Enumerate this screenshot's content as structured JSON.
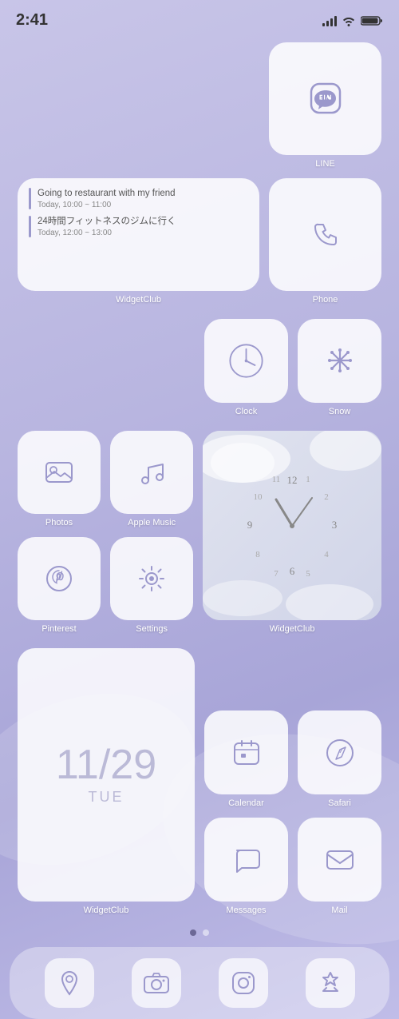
{
  "statusBar": {
    "time": "2:41",
    "signal": "●●●●",
    "wifi": "wifi",
    "battery": "battery"
  },
  "rows": [
    {
      "id": "row1",
      "items": [
        {
          "id": "widgetclub-schedule",
          "type": "widget-large",
          "label": "WidgetClub",
          "events": [
            {
              "title": "Going to restaurant with my friend",
              "time": "Today, 10:00 ~ 11:00"
            },
            {
              "title": "24時間フィットネスのジムに行く",
              "time": "Today, 12:00 ~ 13:00"
            }
          ]
        },
        {
          "id": "line",
          "type": "app",
          "label": "LINE",
          "icon": "line"
        },
        {
          "id": "phone",
          "type": "app",
          "label": "Phone",
          "icon": "phone"
        }
      ]
    },
    {
      "id": "row2",
      "items": [
        {
          "id": "clock",
          "type": "app",
          "label": "Clock",
          "icon": "clock"
        },
        {
          "id": "snow",
          "type": "app",
          "label": "Snow",
          "icon": "snow"
        }
      ]
    },
    {
      "id": "row3",
      "items": [
        {
          "id": "photos",
          "type": "app",
          "label": "Photos",
          "icon": "photos"
        },
        {
          "id": "apple-music",
          "type": "app",
          "label": "Apple Music",
          "icon": "music"
        },
        {
          "id": "widgetclub-clock",
          "type": "widget-clock",
          "label": "WidgetClub",
          "icon": "clock-widget"
        }
      ]
    },
    {
      "id": "row4",
      "items": [
        {
          "id": "pinterest",
          "type": "app",
          "label": "Pinterest",
          "icon": "pinterest"
        },
        {
          "id": "settings",
          "type": "app",
          "label": "Settings",
          "icon": "settings"
        }
      ]
    },
    {
      "id": "row5",
      "items": [
        {
          "id": "widgetclub-date",
          "type": "widget-date",
          "label": "WidgetClub",
          "date": "11/29",
          "day": "TUE"
        },
        {
          "id": "calendar",
          "type": "app",
          "label": "Calendar",
          "icon": "calendar"
        },
        {
          "id": "safari",
          "type": "app",
          "label": "Safari",
          "icon": "safari"
        },
        {
          "id": "messages",
          "type": "app",
          "label": "Messages",
          "icon": "messages"
        },
        {
          "id": "mail",
          "type": "app",
          "label": "Mail",
          "icon": "mail"
        }
      ]
    }
  ],
  "dock": {
    "items": [
      {
        "id": "maps",
        "icon": "maps",
        "label": "Maps"
      },
      {
        "id": "camera",
        "icon": "camera",
        "label": "Camera"
      },
      {
        "id": "instagram",
        "icon": "instagram",
        "label": "Instagram"
      },
      {
        "id": "appstore",
        "icon": "appstore",
        "label": "App Store"
      }
    ]
  },
  "pageDots": {
    "active": 0,
    "total": 2
  },
  "colors": {
    "iconColor": "#9b98cc",
    "background": "#b8b5e0",
    "iconBg": "rgba(255,255,255,0.85)"
  }
}
